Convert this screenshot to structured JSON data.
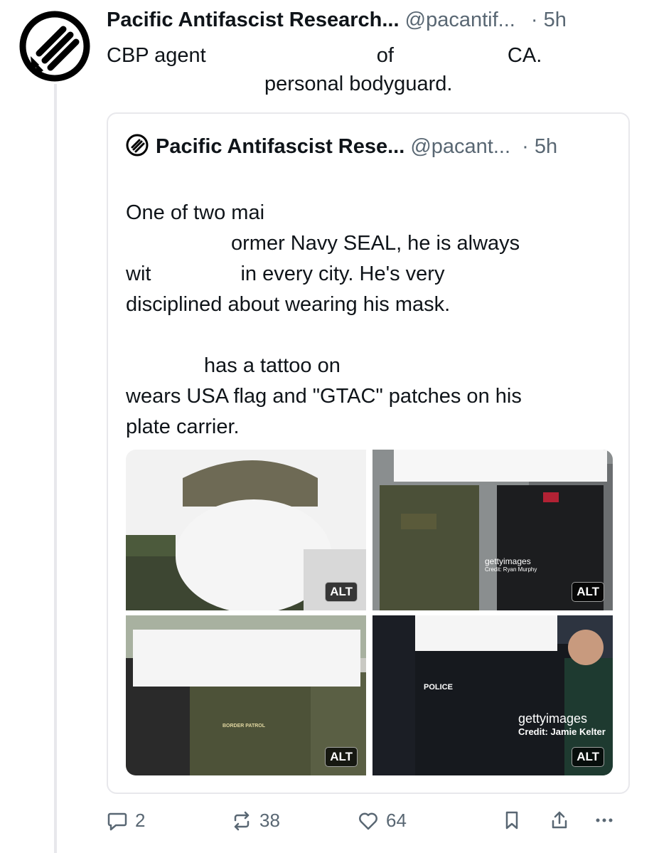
{
  "post": {
    "author_name": "Pacific Antifascist Research...",
    "handle": "@pacantif...",
    "time": "· 5h",
    "text_line1_a": "CBP agent",
    "text_line1_b": "of",
    "text_line1_c": "CA.",
    "text_line2": "personal bodyguard."
  },
  "quote": {
    "author_name": "Pacific Antifascist Rese...",
    "handle": "@pacant...",
    "time": "· 5h",
    "para1_line1": "One of two mai",
    "para1_line2": "ormer Navy SEAL, he is always",
    "para1_line3a": "wit",
    "para1_line3b": "in every city. He's very",
    "para1_line4": "disciplined about wearing his mask.",
    "para2_line1": "has a tattoo on",
    "para2_line2": "wears USA flag and \"GTAC\" patches on his",
    "para2_line3": "plate carrier."
  },
  "media": {
    "alt_label": "ALT",
    "getty_logo": "gettyimages",
    "credit_1": "Credit: Ryan Murphy",
    "credit_2": "Credit: Jamie Kelter",
    "patch_1": "BORDER PATROL",
    "patch_2": "POLICE"
  },
  "actions": {
    "replies": "2",
    "reposts": "38",
    "likes": "64"
  },
  "icons": {
    "avatar": "three-arrows-logo",
    "reply": "speech-bubble-icon",
    "repost": "repost-arrows-icon",
    "like": "heart-icon",
    "bookmark": "bookmark-icon",
    "share": "share-icon",
    "more": "more-dots-icon"
  },
  "colors": {
    "text": "#0f1419",
    "muted": "#596773",
    "border": "#e8e8ec"
  }
}
